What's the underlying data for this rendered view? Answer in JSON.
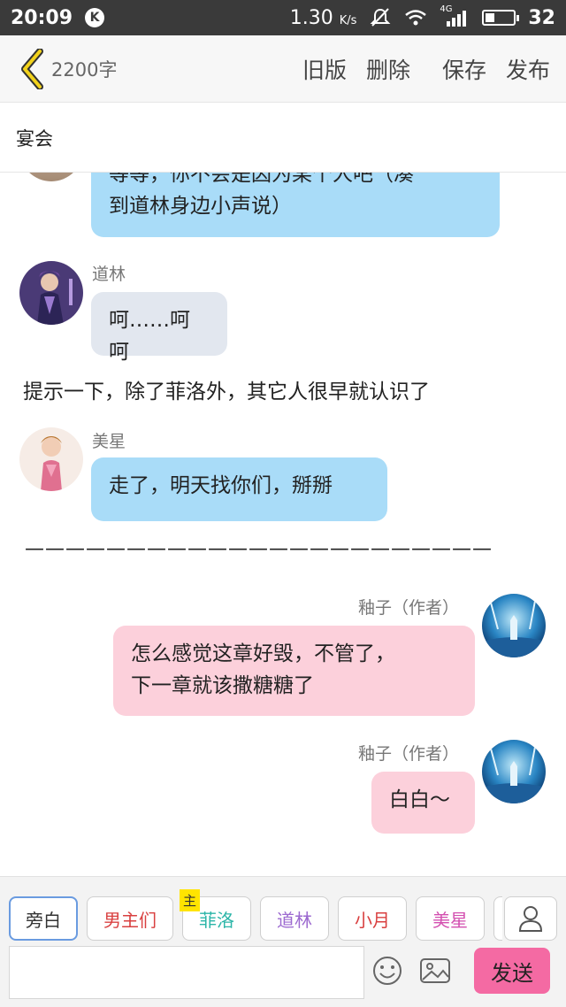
{
  "status_bar": {
    "time": "20:09",
    "badge": "K",
    "speed": "1.30",
    "speed_unit": "K/s",
    "network": "4G",
    "battery": "32",
    "battery_fraction": 0.32
  },
  "nav": {
    "word_count": "2200字",
    "actions": [
      "旧版",
      "删除",
      "保存",
      "发布"
    ]
  },
  "chapter_title": "宴会",
  "messages": [
    {
      "speaker": "",
      "text_lines": [
        "等等，你不会是因为某个人吧（凑",
        "到道林身边小声说）"
      ]
    },
    {
      "speaker": "道林",
      "text": "呵……呵呵"
    },
    {
      "narration": "提示一下，除了菲洛外，其它人很早就认识了"
    },
    {
      "speaker": "美星",
      "text": "走了，明天找你们，掰掰"
    },
    {
      "divider": "———————————————————————"
    },
    {
      "speaker": "釉子（作者）",
      "text_lines": [
        "怎么感觉这章好毁，不管了，",
        "下一章就该撒糖糖了"
      ]
    },
    {
      "speaker": "釉子（作者）",
      "text": "白白～"
    }
  ],
  "roles": [
    "旁白",
    "男主们",
    "菲洛",
    "道林",
    "小月",
    "美星"
  ],
  "main_tag": "主",
  "role_colors": {
    "旁白": "#333333",
    "男主们": "#d94040",
    "菲洛": "#2bb5a8",
    "道林": "#9c6ad0",
    "小月": "#d94040",
    "美星": "#d34fb0"
  },
  "input": {
    "placeholder": "",
    "value": ""
  },
  "send_label": "发送",
  "icons": [
    "back-chevron-icon",
    "emoji-icon",
    "image-icon",
    "user-icon"
  ]
}
